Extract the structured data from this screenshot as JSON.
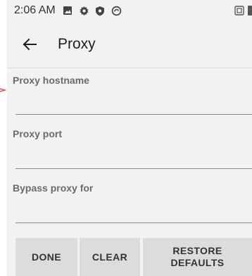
{
  "status_bar": {
    "time": "2:06 AM",
    "icons": [
      "image-icon",
      "gear-icon",
      "shield-icon",
      "circle-icon"
    ],
    "right_icons": [
      "vibrate-icon",
      "battery-icon"
    ]
  },
  "app_bar": {
    "title": "Proxy",
    "back_icon": "arrow-left-icon"
  },
  "fields": {
    "hostname": {
      "label": "Proxy hostname",
      "value": ""
    },
    "port": {
      "label": "Proxy port",
      "value": ""
    },
    "bypass": {
      "label": "Bypass proxy for",
      "value": ""
    }
  },
  "buttons": {
    "done": "DONE",
    "clear": "CLEAR",
    "restore": "RESTORE DEFAULTS"
  },
  "colors": {
    "screen_bg": "#f2f2f2",
    "button_bg": "#dcdcdc",
    "label": "#6b6b6b",
    "cursor": "#d24a3a"
  }
}
